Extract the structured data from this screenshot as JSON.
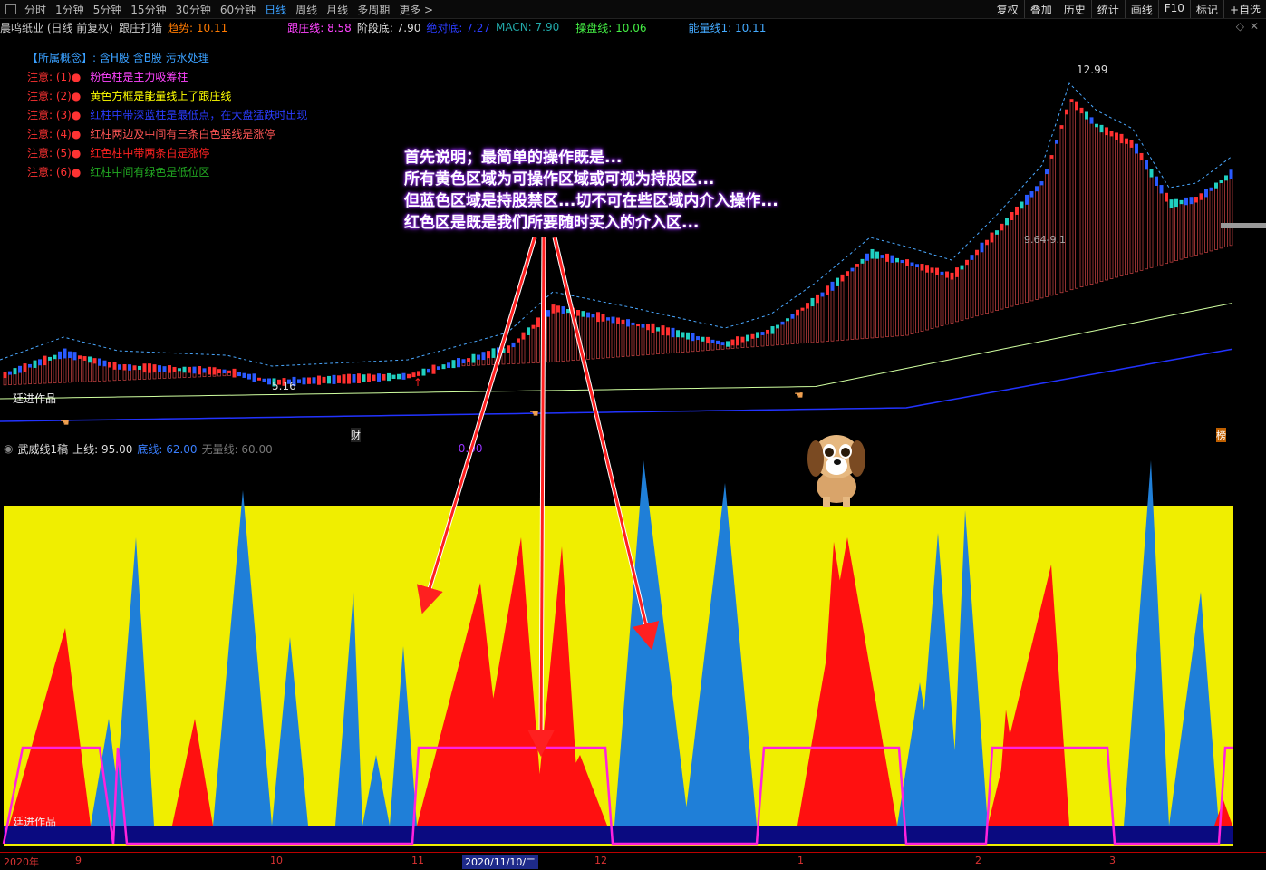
{
  "toolbar": {
    "tabs": [
      "分时",
      "1分钟",
      "5分钟",
      "15分钟",
      "30分钟",
      "60分钟",
      "日线",
      "周线",
      "月线",
      "多周期",
      "更多 >"
    ],
    "right_tabs": [
      "复权",
      "叠加",
      "历史",
      "统计",
      "画线",
      "F10",
      "标记",
      "+自选"
    ]
  },
  "info": {
    "stock": "晨鸣纸业 (日线 前复权)",
    "indicator": "跟庄打猎",
    "trend": "趋势: 10.11",
    "gzx": "跟庄线: 8.58",
    "jdd": "阶段底: 7.90",
    "jdd2": "绝对底: 7.27",
    "macn": "MACN: 7.90",
    "cpx": "操盘线: 10.06",
    "nlx": "能量线1: 10.11"
  },
  "notes": {
    "concept": "【所属概念】: 含H股 含B股 污水处理",
    "items": [
      {
        "prefix": "注意: (1)●",
        "text": "粉色柱是主力吸筹柱",
        "color": "#ff44ff"
      },
      {
        "prefix": "注意: (2)●",
        "text": "黄色方框是能量线上了跟庄线",
        "color": "#ffff00"
      },
      {
        "prefix": "注意: (3)●",
        "text": "红柱中带深蓝柱是最低点，在大盘猛跌时出现",
        "color": "#2b3cff"
      },
      {
        "prefix": "注意: (4)●",
        "text": "红柱两边及中间有三条白色竖线是涨停",
        "color": "#ff5555"
      },
      {
        "prefix": "注意: (5)●",
        "text": "红色柱中带两条白是涨停",
        "color": "#ff2222"
      },
      {
        "prefix": "注意: (6)●",
        "text": "红柱中间有绿色是低位区",
        "color": "#22aa22"
      }
    ]
  },
  "price_labels": {
    "high": "12.99",
    "low": "5.16",
    "mid": "9.64-9.1",
    "author": "廷进作品",
    "cai": "财",
    "bang": "榜"
  },
  "sub": {
    "title": "武威线1稿",
    "upper": "上线: 95.00",
    "bottom": "底线: 62.00",
    "line3": "无量线: 60.00",
    "line4": "0.00"
  },
  "annotation": {
    "lines": [
      "首先说明；最简单的操作既是...",
      "所有黄色区域为可操作区域或可视为持股区...",
      "但蓝色区域是持股禁区...切不可在些区域内介入操作...",
      "红色区是既是我们所要随时买入的介入区..."
    ]
  },
  "xaxis": {
    "labels": [
      "2020年",
      "9",
      "10",
      "11",
      "2020/11/10/二",
      "12",
      "1",
      "2",
      "3"
    ]
  },
  "colors": {
    "yellow": "#f0ee00",
    "blue": "#1f7fd8",
    "red": "#ff1010",
    "magenta": "#ff22dd",
    "navy": "#0a0a80"
  }
}
